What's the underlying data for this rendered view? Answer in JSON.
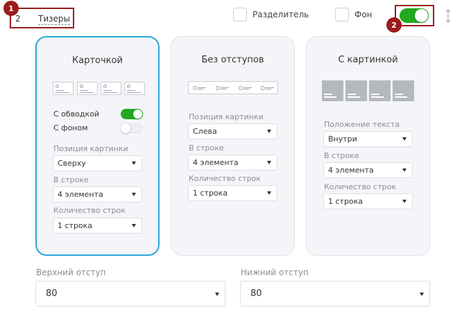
{
  "header": {
    "count": "2",
    "title": "Тизеры",
    "badge1": "1",
    "badge2": "2",
    "divider_label": "Разделитель",
    "background_label": "Фон"
  },
  "cards": [
    {
      "title": "Карточкой",
      "with_border_label": "С обводкой",
      "with_bg_label": "С фоном",
      "image_position_label": "Позиция картинки",
      "image_position_value": "Сверху",
      "per_row_label": "В строке",
      "per_row_value": "4 элемента",
      "rows_label": "Количество строк",
      "rows_value": "1 строка"
    },
    {
      "title": "Без отступов",
      "image_position_label": "Позиция картинки",
      "image_position_value": "Слева",
      "per_row_label": "В строке",
      "per_row_value": "4 элемента",
      "rows_label": "Количество строк",
      "rows_value": "1 строка"
    },
    {
      "title": "С картинкой",
      "text_position_label": "Положение текста",
      "text_position_value": "Внутри",
      "per_row_label": "В строке",
      "per_row_value": "4 элемента",
      "rows_label": "Количество строк",
      "rows_value": "1 строка"
    }
  ],
  "bottom": {
    "top_padding_label": "Верхний отступ",
    "top_padding_value": "80",
    "bottom_padding_label": "Нижний отступ",
    "bottom_padding_value": "80"
  },
  "colors": {
    "accent": "#2ba6d8",
    "toggle_on": "#22a91f",
    "annotation": "#9b1b1b"
  }
}
